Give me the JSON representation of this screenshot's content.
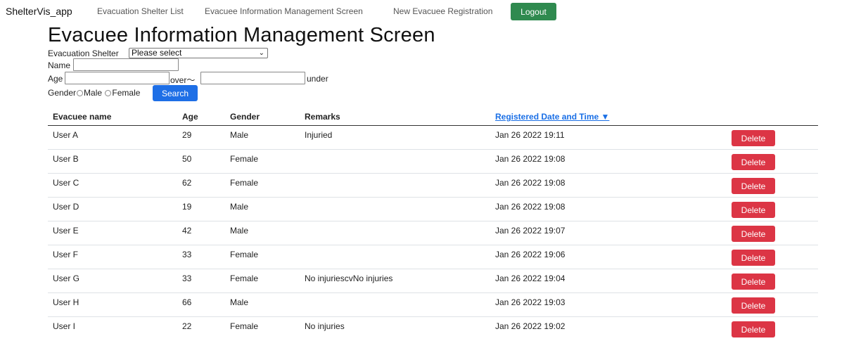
{
  "nav": {
    "brand": "ShelterVis_app",
    "links": [
      "Evacuation Shelter List",
      "Evacuee Information Management Screen",
      "New Evacuee Registration"
    ],
    "logout": "Logout"
  },
  "page_title": "Evacuee Information Management Screen",
  "filter": {
    "shelter_label": "Evacuation Shelter",
    "shelter_selected": "Please select",
    "name_label": "Name",
    "age_label": "Age",
    "over_label": "over～",
    "under_label": "under",
    "gender_label": "Gender",
    "male_label": "Male",
    "female_label": "Female",
    "search_button": "Search"
  },
  "table": {
    "headers": {
      "name": "Evacuee name",
      "age": "Age",
      "gender": "Gender",
      "remarks": "Remarks",
      "registered": "Registered Date and Time ▼"
    },
    "delete_label": "Delete",
    "rows": [
      {
        "name": "User A",
        "age": "29",
        "gender": "Male",
        "remarks": "Injuried",
        "registered": "Jan 26 2022 19:11"
      },
      {
        "name": "User B",
        "age": "50",
        "gender": "Female",
        "remarks": "",
        "registered": "Jan 26 2022 19:08"
      },
      {
        "name": "User C",
        "age": "62",
        "gender": "Female",
        "remarks": "",
        "registered": "Jan 26 2022 19:08"
      },
      {
        "name": "User D",
        "age": "19",
        "gender": "Male",
        "remarks": "",
        "registered": "Jan 26 2022 19:08"
      },
      {
        "name": "User E",
        "age": "42",
        "gender": "Male",
        "remarks": "",
        "registered": "Jan 26 2022 19:07"
      },
      {
        "name": "User F",
        "age": "33",
        "gender": "Female",
        "remarks": "",
        "registered": "Jan 26 2022 19:06"
      },
      {
        "name": "User G",
        "age": "33",
        "gender": "Female",
        "remarks": "No injuriescvNo injuries",
        "registered": "Jan 26 2022 19:04"
      },
      {
        "name": "User H",
        "age": "66",
        "gender": "Male",
        "remarks": "",
        "registered": "Jan 26 2022 19:03"
      },
      {
        "name": "User I",
        "age": "22",
        "gender": "Female",
        "remarks": "No injuries",
        "registered": "Jan 26 2022 19:02"
      }
    ]
  }
}
